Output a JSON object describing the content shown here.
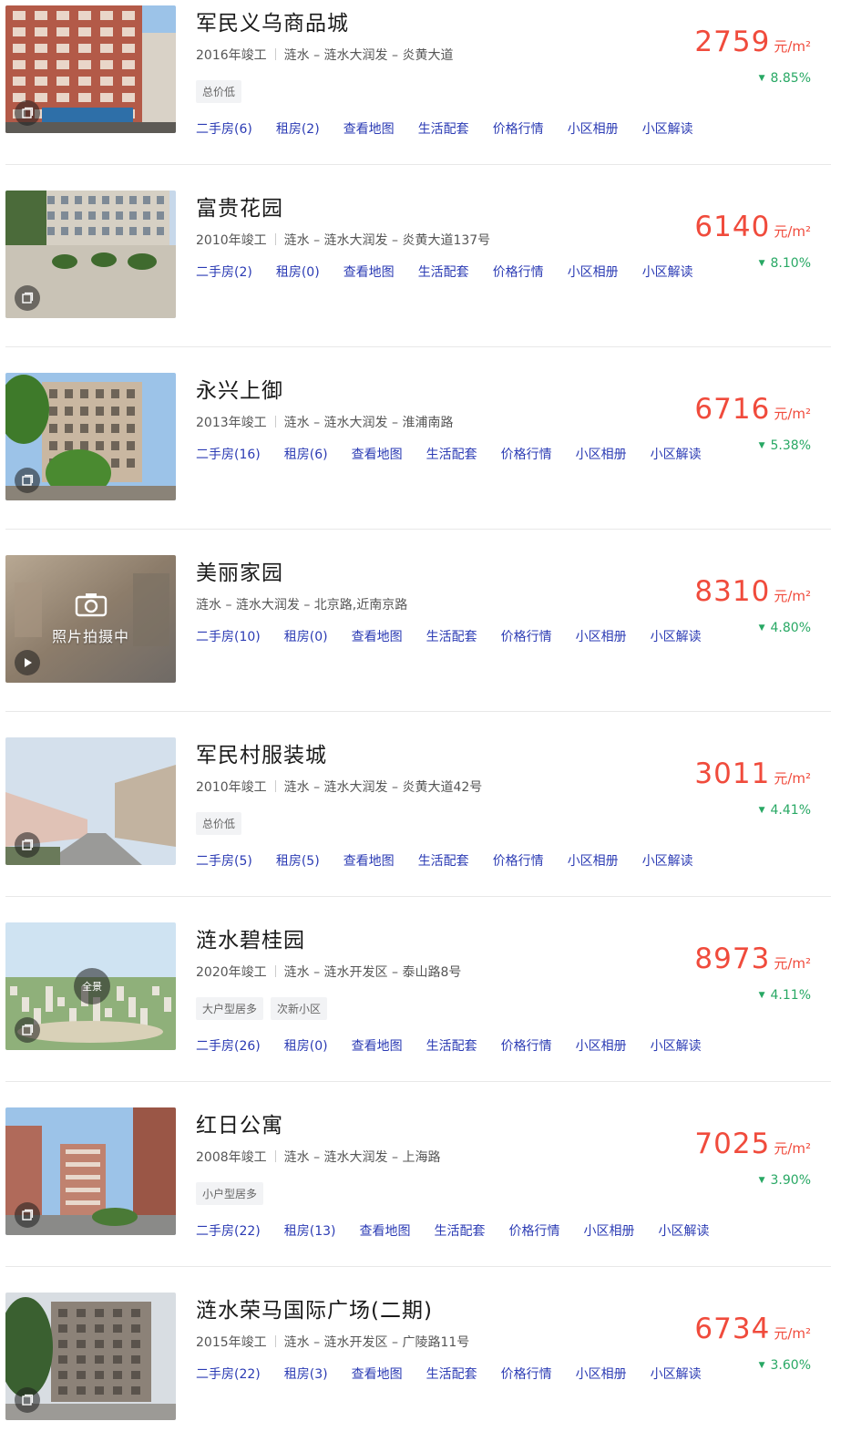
{
  "unit_label": "元/m²",
  "colors": {
    "price": "#f04b3c",
    "change_down": "#28a864",
    "link": "#2b3bb4"
  },
  "listings": [
    {
      "name": "军民义乌商品城",
      "meta": [
        "2016年竣工",
        "涟水 – 涟水大润发 – 炎黄大道"
      ],
      "tags": [
        "总价低"
      ],
      "links": [
        "二手房(6)",
        "租房(2)",
        "查看地图",
        "生活配套",
        "价格行情",
        "小区相册",
        "小区解读"
      ],
      "price": "2759",
      "change": "8.85%",
      "change_direction": "down",
      "thumb": "photo-buildings",
      "badge_icon": "album-icon"
    },
    {
      "name": "富贵花园",
      "meta": [
        "2010年竣工",
        "涟水 – 涟水大润发 – 炎黄大道137号"
      ],
      "tags": [],
      "links": [
        "二手房(2)",
        "租房(0)",
        "查看地图",
        "生活配套",
        "价格行情",
        "小区相册",
        "小区解读"
      ],
      "price": "6140",
      "change": "8.10%",
      "change_direction": "down",
      "thumb": "photo-plaza",
      "badge_icon": "album-icon"
    },
    {
      "name": "永兴上御",
      "meta": [
        "2013年竣工",
        "涟水 – 涟水大润发 – 淮浦南路"
      ],
      "tags": [],
      "links": [
        "二手房(16)",
        "租房(6)",
        "查看地图",
        "生活配套",
        "价格行情",
        "小区相册",
        "小区解读"
      ],
      "price": "6716",
      "change": "5.38%",
      "change_direction": "down",
      "thumb": "photo-trees",
      "badge_icon": "album-icon"
    },
    {
      "name": "美丽家园",
      "meta": [
        "涟水 – 涟水大润发 – 北京路,近南京路"
      ],
      "tags": [],
      "links": [
        "二手房(10)",
        "租房(0)",
        "查看地图",
        "生活配套",
        "价格行情",
        "小区相册",
        "小区解读"
      ],
      "price": "8310",
      "change": "4.80%",
      "change_direction": "down",
      "thumb": "placeholder",
      "placeholder_text": "照片拍摄中",
      "badge_icon": "play-icon"
    },
    {
      "name": "军民村服装城",
      "meta": [
        "2010年竣工",
        "涟水 – 涟水大润发 – 炎黄大道42号"
      ],
      "tags": [
        "总价低"
      ],
      "links": [
        "二手房(5)",
        "租房(5)",
        "查看地图",
        "生活配套",
        "价格行情",
        "小区相册",
        "小区解读"
      ],
      "price": "3011",
      "change": "4.41%",
      "change_direction": "down",
      "thumb": "photo-street",
      "badge_icon": "album-icon"
    },
    {
      "name": "涟水碧桂园",
      "meta": [
        "2020年竣工",
        "涟水 – 涟水开发区 – 泰山路8号"
      ],
      "tags": [
        "大户型居多",
        "次新小区"
      ],
      "links": [
        "二手房(26)",
        "租房(0)",
        "查看地图",
        "生活配套",
        "价格行情",
        "小区相册",
        "小区解读"
      ],
      "price": "8973",
      "change": "4.11%",
      "change_direction": "down",
      "thumb": "photo-aerial",
      "pano_label": "全景",
      "badge_icon": "album-icon"
    },
    {
      "name": "红日公寓",
      "meta": [
        "2008年竣工",
        "涟水 – 涟水大润发 – 上海路"
      ],
      "tags": [
        "小户型居多"
      ],
      "links": [
        "二手房(22)",
        "租房(13)",
        "查看地图",
        "生活配套",
        "价格行情",
        "小区相册",
        "小区解读"
      ],
      "price": "7025",
      "change": "3.90%",
      "change_direction": "down",
      "thumb": "photo-towers",
      "badge_icon": "album-icon"
    },
    {
      "name": "涟水荣马国际广场(二期)",
      "meta": [
        "2015年竣工",
        "涟水 – 涟水开发区 – 广陵路11号"
      ],
      "tags": [],
      "links": [
        "二手房(22)",
        "租房(3)",
        "查看地图",
        "生活配套",
        "价格行情",
        "小区相册",
        "小区解读"
      ],
      "price": "6734",
      "change": "3.60%",
      "change_direction": "down",
      "thumb": "photo-dark",
      "badge_icon": "album-icon"
    }
  ]
}
